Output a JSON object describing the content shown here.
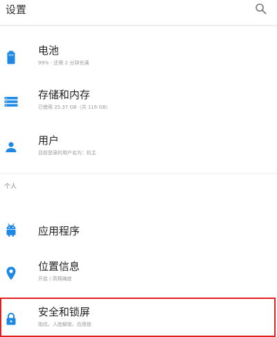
{
  "header": {
    "title": "设置",
    "search_icon": "search-icon"
  },
  "section_label": "个人",
  "items": [
    {
      "label": "电池",
      "subtitle": "99% - 还需 2 分钟充满",
      "icon": "battery-icon"
    },
    {
      "label": "存储和内存",
      "subtitle": "已使用 25.37 GB（共 116 GB）",
      "icon": "storage-icon"
    },
    {
      "label": "用户",
      "subtitle": "目前登录的用户名为：机主",
      "icon": "user-icon"
    },
    {
      "label": "应用程序",
      "subtitle": "",
      "icon": "android-icon"
    },
    {
      "label": "位置信息",
      "subtitle": "开启 / 高精确度",
      "icon": "location-icon"
    },
    {
      "label": "安全和锁屏",
      "subtitle": "指纹、人脸解锁、应用锁",
      "icon": "lock-icon"
    }
  ],
  "colors": {
    "accent": "#1e88e5",
    "highlight_border": "#e02020"
  }
}
